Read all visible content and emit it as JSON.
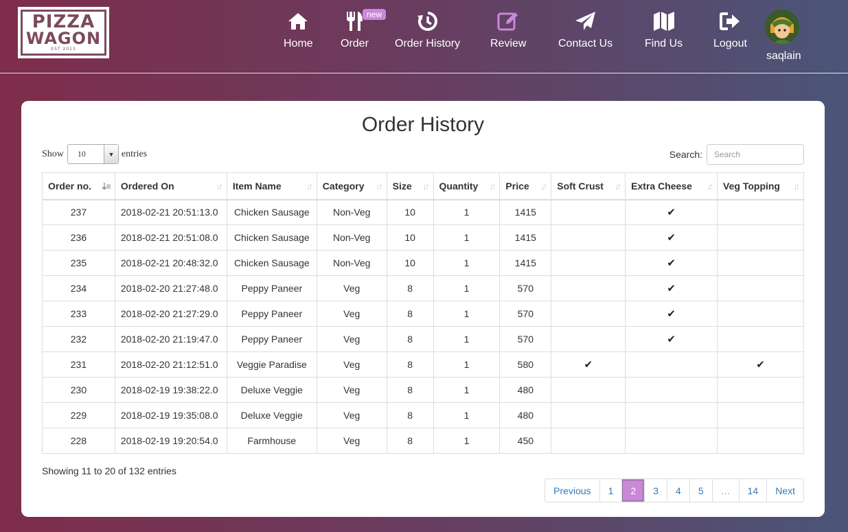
{
  "logo": {
    "line1": "PIZZA",
    "line2": "WAGON",
    "est": "EST 2013"
  },
  "nav": {
    "items": [
      {
        "label": "Home",
        "icon": "home-icon"
      },
      {
        "label": "Order",
        "icon": "cutlery-icon",
        "badge": "new"
      },
      {
        "label": "Order History",
        "icon": "history-icon"
      },
      {
        "label": "Review",
        "icon": "edit-icon"
      },
      {
        "label": "Contact Us",
        "icon": "paper-plane-icon"
      },
      {
        "label": "Find Us",
        "icon": "map-icon"
      },
      {
        "label": "Logout",
        "icon": "logout-icon"
      }
    ],
    "user": {
      "name": "saqlain",
      "icon": "avatar-icon"
    },
    "active_color": "#c989d8"
  },
  "page": {
    "title": "Order History"
  },
  "length_control": {
    "show": "Show",
    "value": "10",
    "entries": "entries"
  },
  "search": {
    "label": "Search:",
    "placeholder": "Search"
  },
  "table": {
    "columns": [
      "Order no.",
      "Ordered On",
      "Item Name",
      "Category",
      "Size",
      "Quantity",
      "Price",
      "Soft Crust",
      "Extra Cheese",
      "Veg Topping"
    ],
    "rows": [
      [
        "237",
        "2018-02-21 20:51:13.0",
        "Chicken Sausage",
        "Non-Veg",
        "10",
        "1",
        "1415",
        "",
        "✔",
        ""
      ],
      [
        "236",
        "2018-02-21 20:51:08.0",
        "Chicken Sausage",
        "Non-Veg",
        "10",
        "1",
        "1415",
        "",
        "✔",
        ""
      ],
      [
        "235",
        "2018-02-21 20:48:32.0",
        "Chicken Sausage",
        "Non-Veg",
        "10",
        "1",
        "1415",
        "",
        "✔",
        ""
      ],
      [
        "234",
        "2018-02-20 21:27:48.0",
        "Peppy Paneer",
        "Veg",
        "8",
        "1",
        "570",
        "",
        "✔",
        ""
      ],
      [
        "233",
        "2018-02-20 21:27:29.0",
        "Peppy Paneer",
        "Veg",
        "8",
        "1",
        "570",
        "",
        "✔",
        ""
      ],
      [
        "232",
        "2018-02-20 21:19:47.0",
        "Peppy Paneer",
        "Veg",
        "8",
        "1",
        "570",
        "",
        "✔",
        ""
      ],
      [
        "231",
        "2018-02-20 21:12:51.0",
        "Veggie Paradise",
        "Veg",
        "8",
        "1",
        "580",
        "✔",
        "",
        "✔"
      ],
      [
        "230",
        "2018-02-19 19:38:22.0",
        "Deluxe Veggie",
        "Veg",
        "8",
        "1",
        "480",
        "",
        "",
        ""
      ],
      [
        "229",
        "2018-02-19 19:35:08.0",
        "Deluxe Veggie",
        "Veg",
        "8",
        "1",
        "480",
        "",
        "",
        ""
      ],
      [
        "228",
        "2018-02-19 19:20:54.0",
        "Farmhouse",
        "Veg",
        "8",
        "1",
        "450",
        "",
        "",
        ""
      ]
    ]
  },
  "info": "Showing 11 to 20 of 132 entries",
  "pagination": {
    "previous": "Previous",
    "pages": [
      "1",
      "2",
      "3",
      "4",
      "5",
      "…",
      "14"
    ],
    "active": "2",
    "next": "Next"
  }
}
